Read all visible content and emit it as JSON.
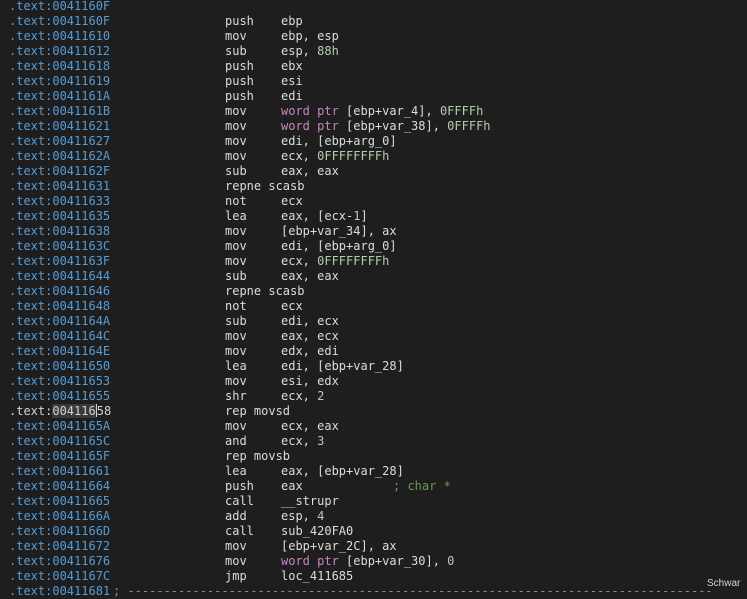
{
  "colors": {
    "background": "#1e1e1e",
    "address": "#569cd6",
    "text": "#dcdcdc",
    "keyword": "#c586c0",
    "number": "#b5cea8",
    "comment": "#6a9955"
  },
  "cursor_line": 27,
  "lines": [
    {
      "addr": ".text:0041160F",
      "mn": "",
      "ops": []
    },
    {
      "addr": ".text:0041160F",
      "mn": "push",
      "ops": [
        {
          "t": "ebp",
          "c": "x"
        }
      ]
    },
    {
      "addr": ".text:00411610",
      "mn": "mov",
      "ops": [
        {
          "t": "ebp, esp",
          "c": "x"
        }
      ]
    },
    {
      "addr": ".text:00411612",
      "mn": "sub",
      "ops": [
        {
          "t": "esp, ",
          "c": "x"
        },
        {
          "t": "88h",
          "c": "n"
        }
      ]
    },
    {
      "addr": ".text:00411618",
      "mn": "push",
      "ops": [
        {
          "t": "ebx",
          "c": "x"
        }
      ]
    },
    {
      "addr": ".text:00411619",
      "mn": "push",
      "ops": [
        {
          "t": "esi",
          "c": "x"
        }
      ]
    },
    {
      "addr": ".text:0041161A",
      "mn": "push",
      "ops": [
        {
          "t": "edi",
          "c": "x"
        }
      ]
    },
    {
      "addr": ".text:0041161B",
      "mn": "mov",
      "ops": [
        {
          "t": "word ptr",
          "c": "k"
        },
        {
          "t": " [ebp+var_4], ",
          "c": "x"
        },
        {
          "t": "0FFFFh",
          "c": "n"
        }
      ]
    },
    {
      "addr": ".text:00411621",
      "mn": "mov",
      "ops": [
        {
          "t": "word ptr",
          "c": "k"
        },
        {
          "t": " [ebp+var_38], ",
          "c": "x"
        },
        {
          "t": "0FFFFh",
          "c": "n"
        }
      ]
    },
    {
      "addr": ".text:00411627",
      "mn": "mov",
      "ops": [
        {
          "t": "edi, [ebp+arg_0]",
          "c": "x"
        }
      ]
    },
    {
      "addr": ".text:0041162A",
      "mn": "mov",
      "ops": [
        {
          "t": "ecx, ",
          "c": "x"
        },
        {
          "t": "0FFFFFFFFh",
          "c": "n"
        }
      ]
    },
    {
      "addr": ".text:0041162F",
      "mn": "sub",
      "ops": [
        {
          "t": "eax, eax",
          "c": "x"
        }
      ]
    },
    {
      "addr": ".text:00411631",
      "mn": "repne scasb",
      "ops": []
    },
    {
      "addr": ".text:00411633",
      "mn": "not",
      "ops": [
        {
          "t": "ecx",
          "c": "x"
        }
      ]
    },
    {
      "addr": ".text:00411635",
      "mn": "lea",
      "ops": [
        {
          "t": "eax, [ecx-",
          "c": "x"
        },
        {
          "t": "1",
          "c": "n"
        },
        {
          "t": "]",
          "c": "x"
        }
      ]
    },
    {
      "addr": ".text:00411638",
      "mn": "mov",
      "ops": [
        {
          "t": "[ebp+var_34], ax",
          "c": "x"
        }
      ]
    },
    {
      "addr": ".text:0041163C",
      "mn": "mov",
      "ops": [
        {
          "t": "edi, [ebp+arg_0]",
          "c": "x"
        }
      ]
    },
    {
      "addr": ".text:0041163F",
      "mn": "mov",
      "ops": [
        {
          "t": "ecx, ",
          "c": "x"
        },
        {
          "t": "0FFFFFFFFh",
          "c": "n"
        }
      ]
    },
    {
      "addr": ".text:00411644",
      "mn": "sub",
      "ops": [
        {
          "t": "eax, eax",
          "c": "x"
        }
      ]
    },
    {
      "addr": ".text:00411646",
      "mn": "repne scasb",
      "ops": []
    },
    {
      "addr": ".text:00411648",
      "mn": "not",
      "ops": [
        {
          "t": "ecx",
          "c": "x"
        }
      ]
    },
    {
      "addr": ".text:0041164A",
      "mn": "sub",
      "ops": [
        {
          "t": "edi, ecx",
          "c": "x"
        }
      ]
    },
    {
      "addr": ".text:0041164C",
      "mn": "mov",
      "ops": [
        {
          "t": "eax, ecx",
          "c": "x"
        }
      ]
    },
    {
      "addr": ".text:0041164E",
      "mn": "mov",
      "ops": [
        {
          "t": "edx, edi",
          "c": "x"
        }
      ]
    },
    {
      "addr": ".text:00411650",
      "mn": "lea",
      "ops": [
        {
          "t": "edi, [ebp+var_28]",
          "c": "x"
        }
      ]
    },
    {
      "addr": ".text:00411653",
      "mn": "mov",
      "ops": [
        {
          "t": "esi, edx",
          "c": "x"
        }
      ]
    },
    {
      "addr": ".text:00411655",
      "mn": "shr",
      "ops": [
        {
          "t": "ecx, ",
          "c": "x"
        },
        {
          "t": "2",
          "c": "n"
        }
      ]
    },
    {
      "addr": ".text:00411658",
      "mn": "rep movsd",
      "ops": []
    },
    {
      "addr": ".text:0041165A",
      "mn": "mov",
      "ops": [
        {
          "t": "ecx, eax",
          "c": "x"
        }
      ]
    },
    {
      "addr": ".text:0041165C",
      "mn": "and",
      "ops": [
        {
          "t": "ecx, ",
          "c": "x"
        },
        {
          "t": "3",
          "c": "n"
        }
      ]
    },
    {
      "addr": ".text:0041165F",
      "mn": "rep movsb",
      "ops": []
    },
    {
      "addr": ".text:00411661",
      "mn": "lea",
      "ops": [
        {
          "t": "eax, [ebp+var_28]",
          "c": "x"
        }
      ]
    },
    {
      "addr": ".text:00411664",
      "mn": "push",
      "ops": [
        {
          "t": "eax",
          "c": "x"
        }
      ],
      "comment": "; char *"
    },
    {
      "addr": ".text:00411665",
      "mn": "call",
      "ops": [
        {
          "t": "__strupr",
          "c": "x"
        }
      ]
    },
    {
      "addr": ".text:0041166A",
      "mn": "add",
      "ops": [
        {
          "t": "esp, ",
          "c": "x"
        },
        {
          "t": "4",
          "c": "n"
        }
      ]
    },
    {
      "addr": ".text:0041166D",
      "mn": "call",
      "ops": [
        {
          "t": "sub_420FA0",
          "c": "x"
        }
      ]
    },
    {
      "addr": ".text:00411672",
      "mn": "mov",
      "ops": [
        {
          "t": "[ebp+var_2C], ax",
          "c": "x"
        }
      ]
    },
    {
      "addr": ".text:00411676",
      "mn": "mov",
      "ops": [
        {
          "t": "word ptr",
          "c": "k"
        },
        {
          "t": " [ebp+var_30], ",
          "c": "x"
        },
        {
          "t": "0",
          "c": "n"
        }
      ]
    },
    {
      "addr": ".text:0041167C",
      "mn": "jmp",
      "ops": [
        {
          "t": "loc_411685",
          "c": "x"
        }
      ]
    },
    {
      "addr": ".text:00411681",
      "mn": "",
      "ops": [],
      "separator": "; ---------------------------------------------------------------------------------"
    }
  ],
  "corner_label": "Schwar"
}
